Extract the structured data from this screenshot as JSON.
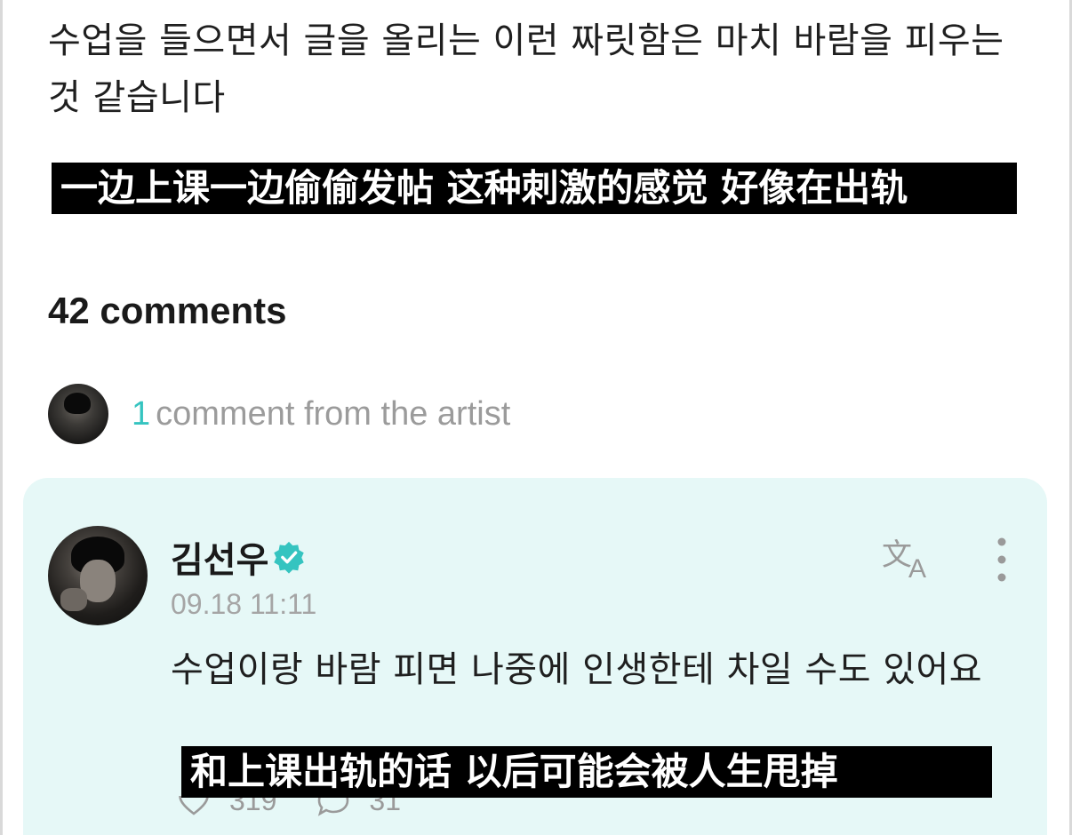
{
  "post": {
    "text": "수업을 들으면서 글을 올리는 이런 짜릿함은 마치 바람을 피우는 것 같습니다",
    "subtitle": "一边上课一边偷偷发帖 这种刺激的感觉 好像在出轨"
  },
  "comments": {
    "count_label": "42 comments"
  },
  "artist_filter": {
    "count": "1",
    "label": "comment from the artist"
  },
  "comment": {
    "username": "김선우",
    "timestamp": "09.18 11:11",
    "text": "수업이랑 바람 피면 나중에 인생한테 차일 수도 있어요",
    "subtitle": "和上课出轨的话 以后可能会被人生甩掉",
    "likes": "319",
    "replies": "31"
  },
  "icons": {
    "verified": "verified-badge-icon",
    "translate": "translate-icon",
    "more": "more-vertical-icon",
    "like": "heart-icon",
    "reply": "reply-bubble-icon"
  },
  "colors": {
    "accent": "#35c4c0",
    "card_background": "#e6f8f7",
    "subtitle_background": "#000000",
    "muted_text": "#9b9b9b"
  }
}
